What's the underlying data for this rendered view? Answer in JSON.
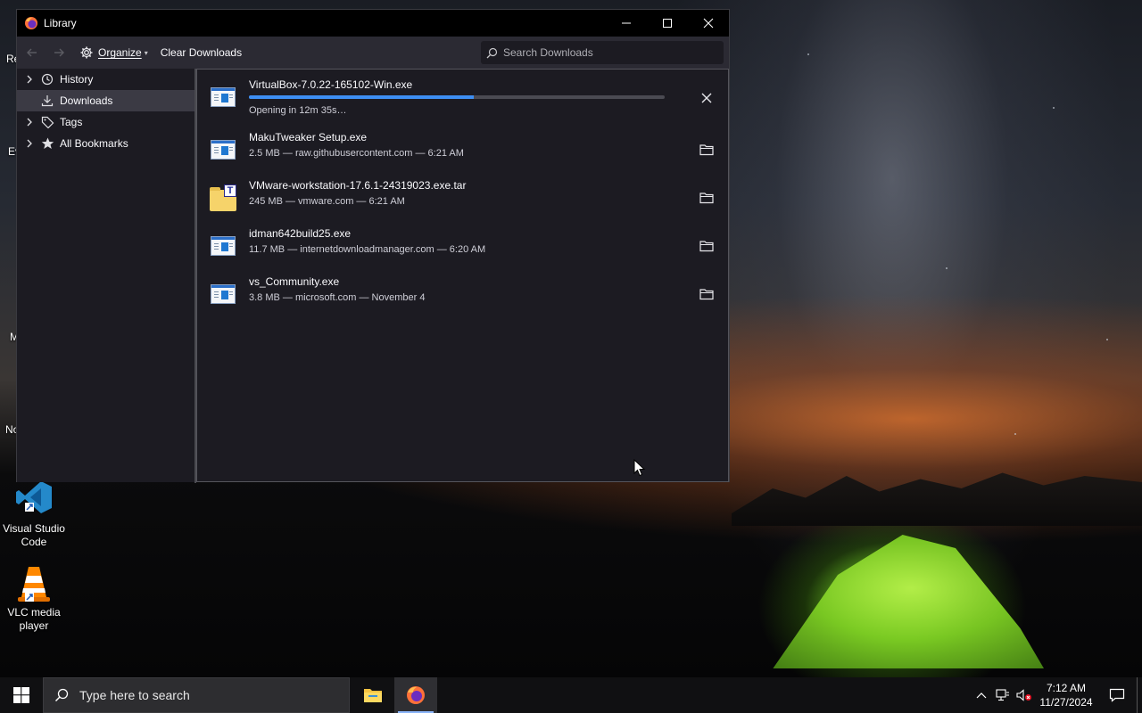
{
  "desktop": {
    "icons": [
      {
        "label": "Visual Studio Code"
      },
      {
        "label": "VLC media player"
      }
    ],
    "clipped_labels": [
      "Re",
      "Ev",
      "M",
      "No"
    ]
  },
  "window": {
    "title": "Library",
    "toolbar": {
      "organize_label": "Organize",
      "clear_downloads_label": "Clear Downloads",
      "search_placeholder": "Search Downloads"
    },
    "sidebar": {
      "items": [
        {
          "label": "History",
          "expandable": true,
          "selected": false,
          "icon": "history-icon"
        },
        {
          "label": "Downloads",
          "expandable": false,
          "selected": true,
          "icon": "download-icon"
        },
        {
          "label": "Tags",
          "expandable": true,
          "selected": false,
          "icon": "tag-icon"
        },
        {
          "label": "All Bookmarks",
          "expandable": true,
          "selected": false,
          "icon": "star-icon"
        }
      ]
    },
    "downloads": [
      {
        "name": "VirtualBox-7.0.22-165102-Win.exe",
        "status": "Opening in 12m 35s…",
        "progress": 0.54,
        "file_type": "exe",
        "action": "cancel-icon"
      },
      {
        "name": "MakuTweaker Setup.exe",
        "status": "2.5 MB — raw.githubusercontent.com — 6:21 AM",
        "file_type": "exe",
        "action": "folder-icon"
      },
      {
        "name": "VMware-workstation-17.6.1-24319023.exe.tar",
        "status": "245 MB — vmware.com — 6:21 AM",
        "file_type": "tar",
        "action": "folder-icon"
      },
      {
        "name": "idman642build25.exe",
        "status": "11.7 MB — internetdownloadmanager.com — 6:20 AM",
        "file_type": "exe",
        "action": "folder-icon"
      },
      {
        "name": "vs_Community.exe",
        "status": "3.8 MB — microsoft.com — November 4",
        "file_type": "exe",
        "action": "folder-icon"
      }
    ]
  },
  "taskbar": {
    "search_placeholder": "Type here to search",
    "time": "7:12 AM",
    "date": "11/27/2024"
  },
  "colors": {
    "accent": "#3d8ef2",
    "window_bg": "#1c1b22",
    "toolbar_bg": "#2b2a33",
    "titlebar_bg": "#000000",
    "selected_bg": "#3b3a44",
    "taskbar_bg": "#101012"
  }
}
